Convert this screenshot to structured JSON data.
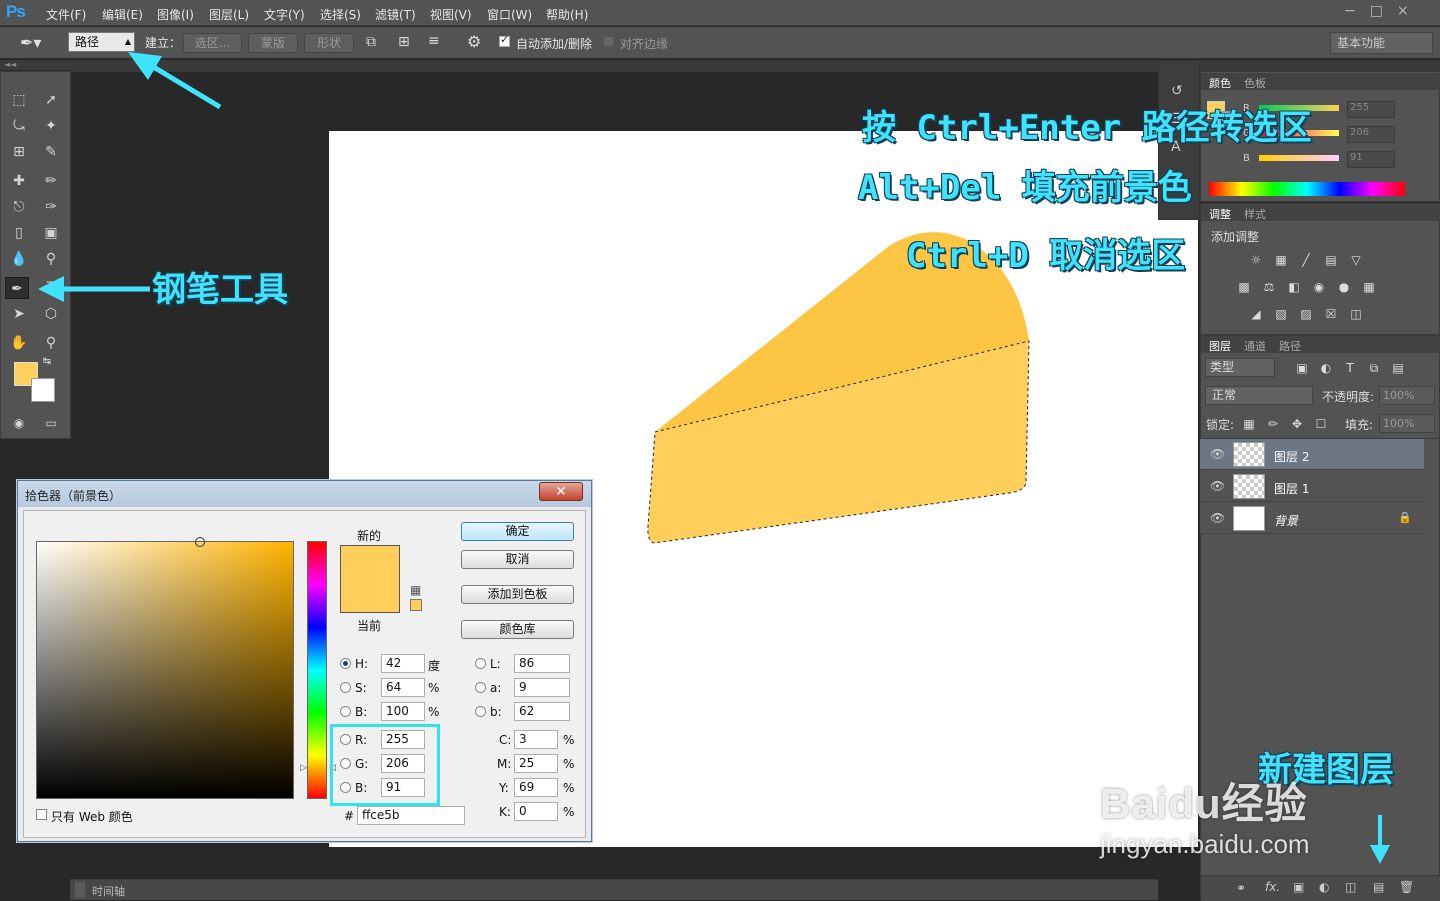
{
  "app": {
    "logo": "Ps"
  },
  "menu": [
    "文件(F)",
    "编辑(E)",
    "图像(I)",
    "图层(L)",
    "文字(Y)",
    "选择(S)",
    "滤镜(T)",
    "视图(V)",
    "窗口(W)",
    "帮助(H)"
  ],
  "options_bar": {
    "mode_select": "路径",
    "build_label": "建立：",
    "selection_btn": "选区...",
    "mask_btn": "蒙版",
    "shape_btn": "形状",
    "auto_add_delete": "自动添加/删除",
    "align_edges": "对齐边缘",
    "workspace": "基本功能"
  },
  "color_panel": {
    "tabs": [
      "颜色",
      "色板"
    ],
    "channels": [
      {
        "label": "R",
        "value": "255"
      },
      {
        "label": "G",
        "value": "206"
      },
      {
        "label": "B",
        "value": "91"
      }
    ]
  },
  "adjust_panel": {
    "tabs": [
      "调整",
      "样式"
    ],
    "heading": "添加调整"
  },
  "layers_panel": {
    "tabs": [
      "图层",
      "通道",
      "路径"
    ],
    "filter": "类型",
    "blend_mode": "正常",
    "opacity_label": "不透明度:",
    "opacity": "100%",
    "lock_label": "锁定:",
    "fill_label": "填充:",
    "fill": "100%",
    "layers": [
      {
        "name": "图层 2",
        "active": true
      },
      {
        "name": "图层 1",
        "active": false
      },
      {
        "name": "背景",
        "active": false
      }
    ]
  },
  "timeline": {
    "label": "时间轴"
  },
  "color_picker": {
    "title": "拾色器（前景色）",
    "new_label": "新的",
    "current_label": "当前",
    "ok": "确定",
    "cancel": "取消",
    "add_swatch": "添加到色板",
    "color_library": "颜色库",
    "web_only": "只有 Web 颜色",
    "hex_prefix": "#",
    "hex": "ffce5b",
    "hsb": [
      {
        "label": "H:",
        "value": "42",
        "unit": "度"
      },
      {
        "label": "S:",
        "value": "64",
        "unit": "%"
      },
      {
        "label": "B:",
        "value": "100",
        "unit": "%"
      }
    ],
    "rgb": [
      {
        "label": "R:",
        "value": "255"
      },
      {
        "label": "G:",
        "value": "206"
      },
      {
        "label": "B:",
        "value": "91"
      }
    ],
    "lab": [
      {
        "label": "L:",
        "value": "86"
      },
      {
        "label": "a:",
        "value": "9"
      },
      {
        "label": "b:",
        "value": "62"
      }
    ],
    "cmyk": [
      {
        "label": "C:",
        "value": "3",
        "unit": "%"
      },
      {
        "label": "M:",
        "value": "25",
        "unit": "%"
      },
      {
        "label": "Y:",
        "value": "69",
        "unit": "%"
      },
      {
        "label": "K:",
        "value": "0",
        "unit": "%"
      }
    ]
  },
  "annotations": {
    "line1": "按 Ctrl+Enter 路径转选区",
    "line2": "Alt+Del 填充前景色",
    "line3": "Ctrl+D 取消选区",
    "pen_tool": "钢笔工具",
    "new_layer": "新建图层"
  },
  "watermark": {
    "brand": "Baidu经验",
    "url": "jingyan.baidu.com"
  },
  "colors": {
    "foreground": "#ffce5b",
    "cake_top": "#fcc543",
    "cake_side": "#ffce5b",
    "annotation": "#3fe3ff"
  }
}
